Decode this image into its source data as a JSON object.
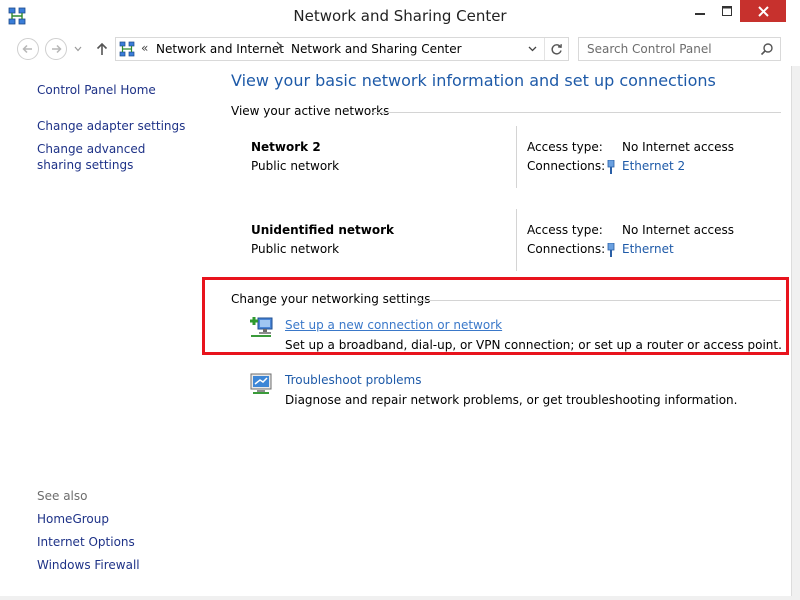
{
  "window": {
    "title": "Network and Sharing Center",
    "controls": {
      "minimize": "minimize-icon",
      "maximize": "maximize-icon",
      "close": "close-icon"
    }
  },
  "nav": {
    "crumbs": [
      "Network and Internet",
      "Network and Sharing Center"
    ],
    "overflow": "«",
    "search_placeholder": "Search Control Panel"
  },
  "left_pane": {
    "links": [
      "Control Panel Home",
      "Change adapter settings",
      "Change advanced sharing settings"
    ],
    "see_also_label": "See also",
    "see_also": [
      "HomeGroup",
      "Internet Options",
      "Windows Firewall"
    ]
  },
  "main": {
    "heading": "View your basic network information and set up connections",
    "active_networks_title": "View your active networks",
    "networks": [
      {
        "name": "Network  2",
        "category": "Public network",
        "access_label": "Access type:",
        "access_value": "No Internet access",
        "connections_label": "Connections:",
        "connection": "Ethernet 2"
      },
      {
        "name": "Unidentified network",
        "category": "Public network",
        "access_label": "Access type:",
        "access_value": "No Internet access",
        "connections_label": "Connections:",
        "connection": "Ethernet"
      }
    ],
    "change_settings_title": "Change your networking settings",
    "tasks": [
      {
        "link": "Set up a new connection or network",
        "desc": "Set up a broadband, dial-up, or VPN connection; or set up a router or access point."
      },
      {
        "link": "Troubleshoot problems",
        "desc": "Diagnose and repair network problems, or get troubleshooting information."
      }
    ]
  },
  "colors": {
    "link": "#1e5aa8",
    "heading": "#1e5aa8",
    "highlight": "#e8131d",
    "close_button": "#c7312d"
  }
}
